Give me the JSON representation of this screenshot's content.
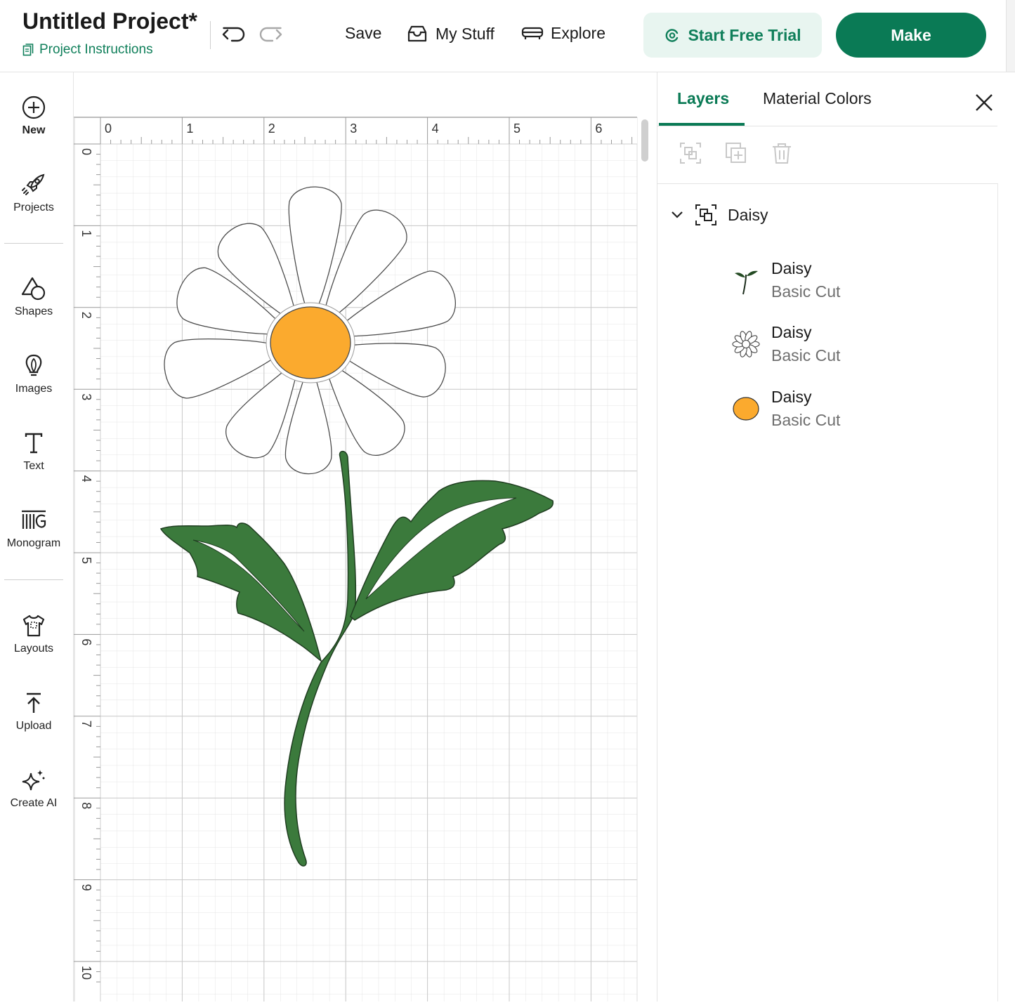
{
  "header": {
    "title": "Untitled Project*",
    "instructions": "Project Instructions",
    "save": "Save",
    "my_stuff": "My Stuff",
    "explore": "Explore",
    "trial": "Start Free Trial",
    "make": "Make"
  },
  "toolbar": {
    "new": "New",
    "projects": "Projects",
    "shapes": "Shapes",
    "images": "Images",
    "text": "Text",
    "monogram": "Monogram",
    "layouts": "Layouts",
    "upload": "Upload",
    "create_ai": "Create AI"
  },
  "ruler": {
    "top": [
      "0",
      "1",
      "2",
      "3",
      "4",
      "5",
      "6"
    ],
    "left": [
      "0",
      "1",
      "2",
      "3",
      "4",
      "5",
      "6",
      "7",
      "8",
      "9",
      "10"
    ]
  },
  "panel": {
    "tabs": [
      "Layers",
      "Material Colors"
    ],
    "group": "Daisy",
    "layers": [
      {
        "name": "Daisy",
        "op": "Basic Cut",
        "icon": "stem-leaves-icon"
      },
      {
        "name": "Daisy",
        "op": "Basic Cut",
        "icon": "petals-icon"
      },
      {
        "name": "Daisy",
        "op": "Basic Cut",
        "icon": "orange-center-icon"
      }
    ]
  },
  "colors": {
    "accent": "#0a7a55",
    "petal": "#ffffff",
    "center": "#fbaa2e",
    "stem": "#3b7a3c"
  }
}
